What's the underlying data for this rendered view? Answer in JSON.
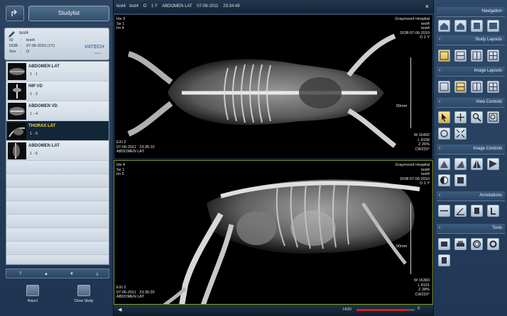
{
  "studylist": {
    "button_label": "Studylist"
  },
  "patient": {
    "name": "test4",
    "rows": [
      {
        "key": "ID",
        "value": "test4"
      },
      {
        "key": "DOB",
        "value": "07-06-2010 (1Y)"
      },
      {
        "key": "Sex",
        "value": "O"
      }
    ],
    "logo": "VATECH",
    "logo_sub": "Partner"
  },
  "series": [
    {
      "name": "ABDOMEN LAT",
      "sub": "1   -   1",
      "active": false
    },
    {
      "name": "HIP VD",
      "sub": "1   -   2",
      "active": false
    },
    {
      "name": "ABDOMEN VD",
      "sub": "1   -   4",
      "active": false
    },
    {
      "name": "THORAX LAT",
      "sub": "1   -   5",
      "active": true
    },
    {
      "name": "ABDOMEN LAT",
      "sub": "1   -   6",
      "active": false
    }
  ],
  "nav_arrows": [
    "⤒",
    "▲",
    "▼",
    "⤓"
  ],
  "bottom_buttons": {
    "reject": "Reject",
    "close_study": "Close Study"
  },
  "viewer": {
    "title": "test4   test4    O    1 Y    ABDOMEN LAT    07-06-2011    23:34:49",
    "close": "×",
    "pane1": {
      "tl": "Idx 3\nSe 1\nIm 4",
      "tr": "Graymount Hospital\ntest4\ntest4\nDOB:07-06-2010\nO 1 Y",
      "bl": "EXI 2\n07-06-2011   23:35:10\nABDOMEN LAT",
      "br": "W 16492\nL 8158\nZ 26%\nCW220°",
      "scale": "50mm"
    },
    "pane2": {
      "tl": "Idx 4\nSe 1\nIm 5",
      "tr": "Graymount Hospital\ntest4\ntest4\nDOB:07-06-2010\nO 1 Y",
      "bl": "EXI 2\n07-06-2011   23:35:20\nABDOMEN LAT",
      "br": "W 16383\nL 8191\nZ 28%\nCW220°",
      "scale": "50mm"
    },
    "footer_left": "◀",
    "footer_label": "HOD",
    "slider_value": 0.88,
    "slider_end": "0"
  },
  "right_panel": {
    "sections": [
      {
        "title": "Navigation",
        "chevron": ""
      },
      {
        "title": "Study Layouts",
        "chevron": "‹"
      },
      {
        "title": "Image Layouts",
        "chevron": "‹"
      },
      {
        "title": "View Controls",
        "chevron": "‹"
      },
      {
        "title": "Image Controls",
        "chevron": "‹"
      },
      {
        "title": "Annotations",
        "chevron": "‹"
      },
      {
        "title": "Tools",
        "chevron": "‹"
      }
    ]
  },
  "colors": {
    "accent_yellow": "#ffd83a",
    "slider_red": "#d02020",
    "active_series_bg": "#132638"
  }
}
